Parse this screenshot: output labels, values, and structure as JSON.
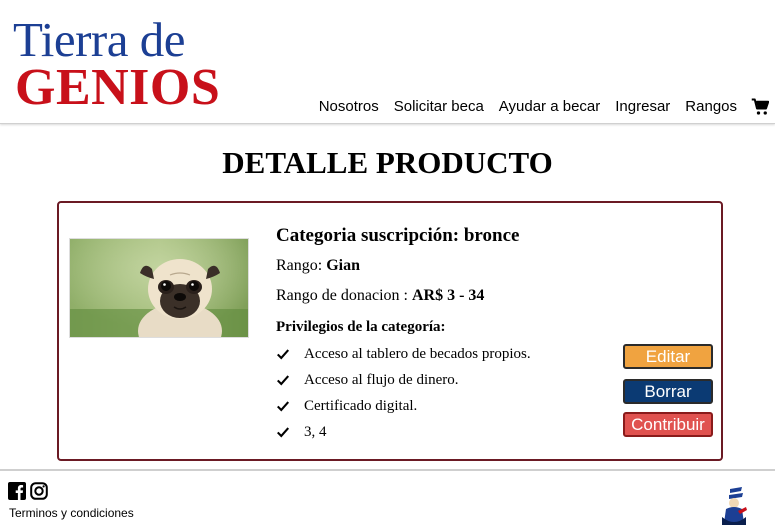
{
  "header": {
    "logo_line1": "Tierra de",
    "logo_line2": "GENIOS",
    "nav": [
      "Nosotros",
      "Solicitar beca",
      "Ayudar a becar",
      "Ingresar",
      "Rangos"
    ],
    "cart_icon": "shopping-cart-icon"
  },
  "page": {
    "title": "DETALLE PRODUCTO"
  },
  "product": {
    "category": "Categoria suscripción: bronce",
    "rank_label": "Rango: ",
    "rank_value": "Gian",
    "donation_label": "Rango de donacion : ",
    "donation_value": "AR$ 3 - 34",
    "privileges_title": "Privilegios de la categoría:",
    "privileges": [
      "Acceso al tablero de becados propios.",
      "Acceso al flujo de dinero.",
      "Certificado digital.",
      "3, 4"
    ],
    "image_icon": "pug-dog-photo"
  },
  "buttons": {
    "edit": "Editar",
    "delete": "Borrar",
    "contribute": "Contribuir"
  },
  "footer": {
    "terms": "Terminos y condiciones",
    "icons": [
      "facebook-icon",
      "instagram-icon"
    ]
  },
  "colors": {
    "logo_blue": "#1c3f94",
    "logo_red": "#c8101a",
    "card_border": "#6b1a24",
    "edit": "#f0a340",
    "delete": "#0b3a73",
    "contribute": "#e0524f"
  }
}
